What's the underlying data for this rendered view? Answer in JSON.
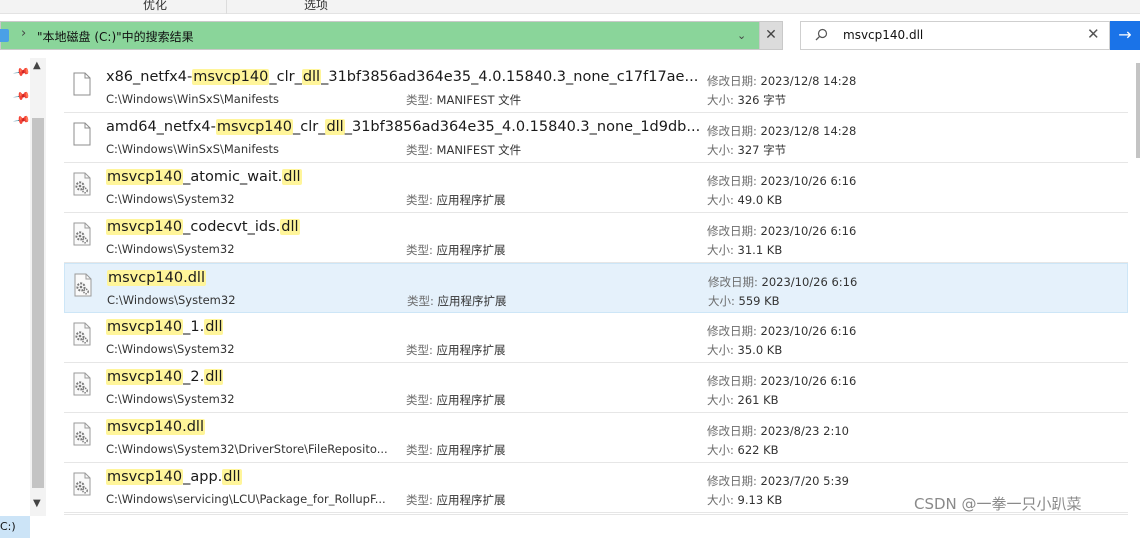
{
  "ribbon": {
    "tab_left": "优化",
    "tab_right": "选项"
  },
  "address": {
    "path": "\"本地磁盘 (C:)\"中的搜索结果",
    "chevron": "›",
    "dropdown": "⌄",
    "close": "✕"
  },
  "search": {
    "query": "msvcp140.dll",
    "clear": "✕",
    "go": "→"
  },
  "nav": {
    "drive_label": "C:)"
  },
  "files": [
    {
      "name_parts": [
        {
          "t": "x86_netfx4-"
        },
        {
          "t": "msvcp140",
          "h": true
        },
        {
          "t": "_clr_"
        },
        {
          "t": "dll",
          "h": true
        },
        {
          "t": "_31bf3856ad364e35_4.0.15840.3_none_c17f17ae..."
        }
      ],
      "path": "C:\\Windows\\WinSxS\\Manifests",
      "type_label": "类型:",
      "type": "MANIFEST 文件",
      "date_label": "修改日期:",
      "date": "2023/12/8 14:28",
      "size_label": "大小:",
      "size": "326 字节",
      "icon": "blank-file-icon"
    },
    {
      "name_parts": [
        {
          "t": "amd64_netfx4-"
        },
        {
          "t": "msvcp140",
          "h": true
        },
        {
          "t": "_clr_"
        },
        {
          "t": "dll",
          "h": true
        },
        {
          "t": "_31bf3856ad364e35_4.0.15840.3_none_1d9db..."
        }
      ],
      "path": "C:\\Windows\\WinSxS\\Manifests",
      "type_label": "类型:",
      "type": "MANIFEST 文件",
      "date_label": "修改日期:",
      "date": "2023/12/8 14:28",
      "size_label": "大小:",
      "size": "327 字节",
      "icon": "blank-file-icon"
    },
    {
      "name_parts": [
        {
          "t": "msvcp140",
          "h": true
        },
        {
          "t": "_atomic_wait."
        },
        {
          "t": "dll",
          "h": true
        }
      ],
      "path": "C:\\Windows\\System32",
      "type_label": "类型:",
      "type": "应用程序扩展",
      "date_label": "修改日期:",
      "date": "2023/10/26 6:16",
      "size_label": "大小:",
      "size": "49.0 KB",
      "icon": "dll-gear-icon"
    },
    {
      "name_parts": [
        {
          "t": "msvcp140",
          "h": true
        },
        {
          "t": "_codecvt_ids."
        },
        {
          "t": "dll",
          "h": true
        }
      ],
      "path": "C:\\Windows\\System32",
      "type_label": "类型:",
      "type": "应用程序扩展",
      "date_label": "修改日期:",
      "date": "2023/10/26 6:16",
      "size_label": "大小:",
      "size": "31.1 KB",
      "icon": "dll-gear-icon"
    },
    {
      "name_parts": [
        {
          "t": "msvcp140.dll",
          "h": true
        }
      ],
      "path": "C:\\Windows\\System32",
      "type_label": "类型:",
      "type": "应用程序扩展",
      "date_label": "修改日期:",
      "date": "2023/10/26 6:16",
      "size_label": "大小:",
      "size": "559 KB",
      "icon": "dll-gear-icon",
      "selected": true
    },
    {
      "name_parts": [
        {
          "t": "msvcp140",
          "h": true
        },
        {
          "t": "_1."
        },
        {
          "t": "dll",
          "h": true
        }
      ],
      "path": "C:\\Windows\\System32",
      "type_label": "类型:",
      "type": "应用程序扩展",
      "date_label": "修改日期:",
      "date": "2023/10/26 6:16",
      "size_label": "大小:",
      "size": "35.0 KB",
      "icon": "dll-gear-icon"
    },
    {
      "name_parts": [
        {
          "t": "msvcp140",
          "h": true
        },
        {
          "t": "_2."
        },
        {
          "t": "dll",
          "h": true
        }
      ],
      "path": "C:\\Windows\\System32",
      "type_label": "类型:",
      "type": "应用程序扩展",
      "date_label": "修改日期:",
      "date": "2023/10/26 6:16",
      "size_label": "大小:",
      "size": "261 KB",
      "icon": "dll-gear-icon"
    },
    {
      "name_parts": [
        {
          "t": "msvcp140.dll",
          "h": true
        }
      ],
      "path": "C:\\Windows\\System32\\DriverStore\\FileReposito...",
      "type_label": "类型:",
      "type": "应用程序扩展",
      "date_label": "修改日期:",
      "date": "2023/8/23 2:10",
      "size_label": "大小:",
      "size": "622 KB",
      "icon": "dll-gear-icon"
    },
    {
      "name_parts": [
        {
          "t": "msvcp140",
          "h": true
        },
        {
          "t": "_app."
        },
        {
          "t": "dll",
          "h": true
        }
      ],
      "path": "C:\\Windows\\servicing\\LCU\\Package_for_RollupF...",
      "type_label": "类型:",
      "type": "应用程序扩展",
      "date_label": "修改日期:",
      "date": "2023/7/20 5:39",
      "size_label": "大小:",
      "size": "9.13 KB",
      "icon": "dll-gear-icon"
    }
  ],
  "watermark": "CSDN @一拳一只小趴菜",
  "colors": {
    "address_bg": "#8ad59a",
    "selected_row": "#e5f1fb",
    "highlight": "#fff59a",
    "go_button": "#1a73e8"
  }
}
